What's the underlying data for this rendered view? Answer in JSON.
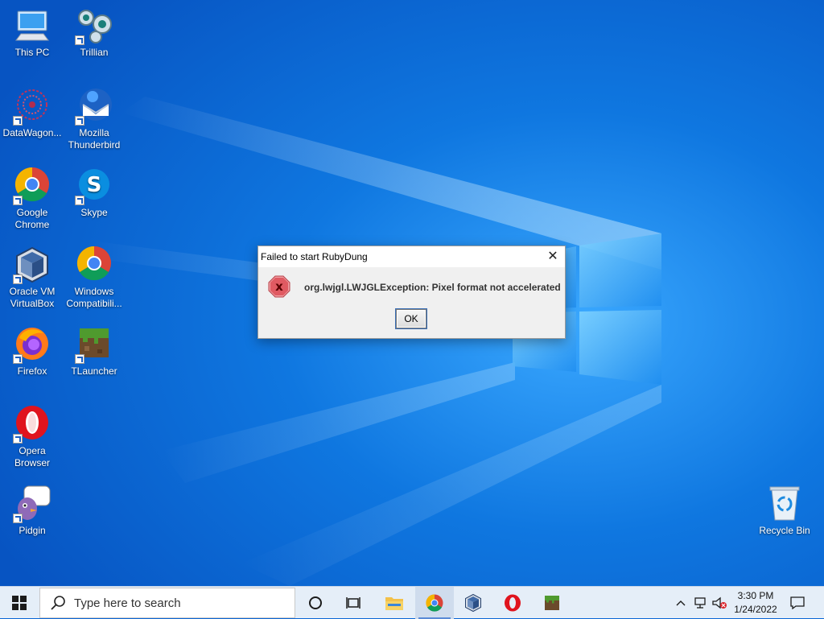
{
  "desktop": {
    "icons": [
      {
        "label": "This PC",
        "icon": "this-pc-icon"
      },
      {
        "label": "Trillian",
        "icon": "trillian-icon"
      },
      {
        "label": "DataWagon...",
        "icon": "datawagon-icon"
      },
      {
        "label": "Mozilla\nThunderbird",
        "icon": "thunderbird-icon"
      },
      {
        "label": "Google\nChrome",
        "icon": "chrome-icon"
      },
      {
        "label": "Skype",
        "icon": "skype-icon"
      },
      {
        "label": "Oracle VM\nVirtualBox",
        "icon": "virtualbox-icon"
      },
      {
        "label": "Windows\nCompatibili...",
        "icon": "chrome-icon"
      },
      {
        "label": "Firefox",
        "icon": "firefox-icon"
      },
      {
        "label": "TLauncher",
        "icon": "tlauncher-icon"
      },
      {
        "label": "Opera\nBrowser",
        "icon": "opera-icon"
      },
      {
        "label": "Pidgin",
        "icon": "pidgin-icon"
      },
      {
        "label": "Recycle Bin",
        "icon": "recycle-bin-icon"
      }
    ]
  },
  "dialog": {
    "title": "Failed to start RubyDung",
    "message": "org.lwjgl.LWJGLException: Pixel format not accelerated",
    "ok_label": "OK",
    "close_glyph": "✕",
    "error_glyph": "x"
  },
  "taskbar": {
    "search_placeholder": "Type here to search",
    "pinned": [
      "file-explorer-icon",
      "chrome-icon",
      "virtualbox-icon",
      "opera-icon",
      "tlauncher-icon"
    ],
    "active_pinned": "chrome-icon",
    "clock": {
      "time": "3:30 PM",
      "date": "1/24/2022"
    }
  },
  "colors": {
    "wallpaper_dark": "#0a5ed0",
    "wallpaper_light": "#2b9cf5",
    "taskbar": "#e5eef8",
    "dialog_bg": "#f0f0f0",
    "error_red": "#d9242b"
  }
}
